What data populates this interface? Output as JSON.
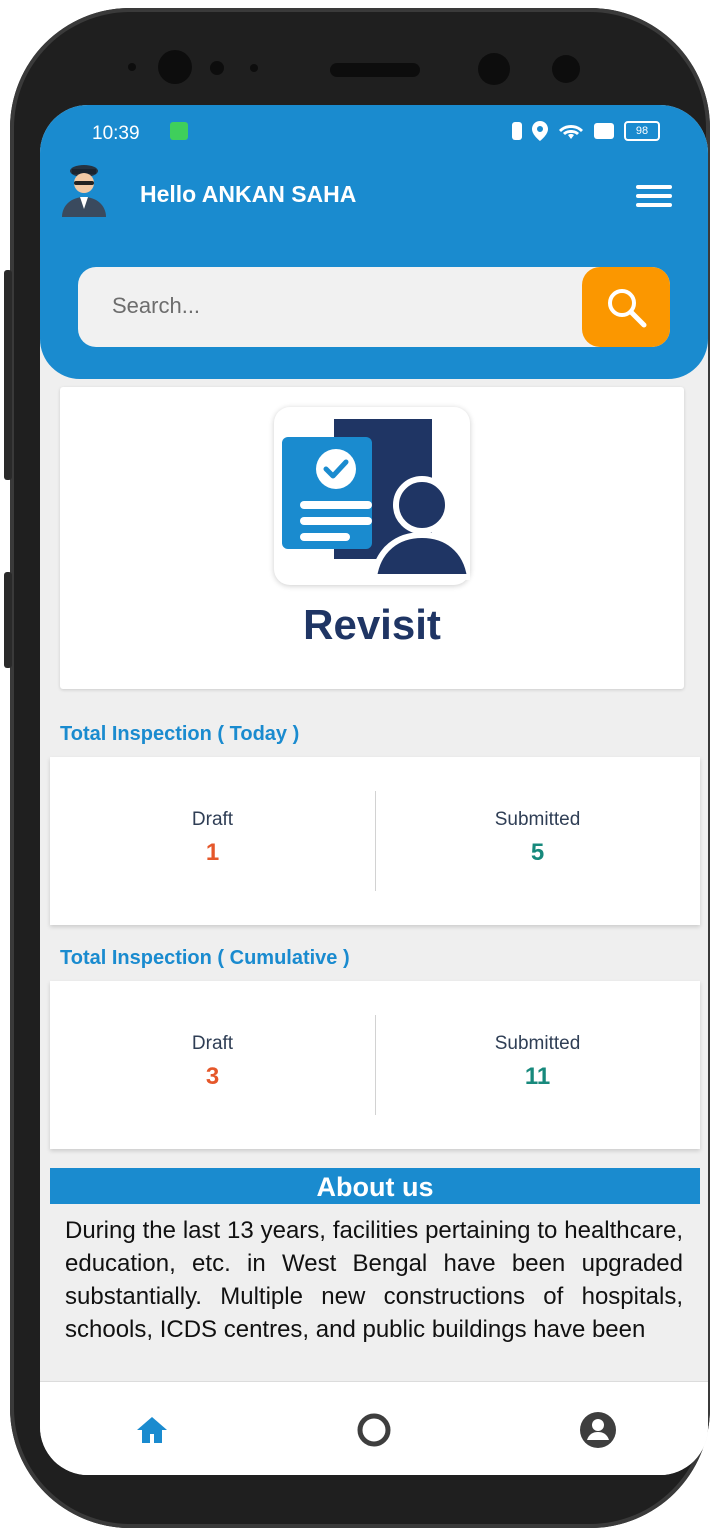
{
  "status_bar": {
    "time": "10:39",
    "battery": "98",
    "icons": [
      "vibrate-icon",
      "location-icon",
      "wifi-icon",
      "message-icon",
      "battery-icon"
    ]
  },
  "header": {
    "greeting": "Hello  ANKAN SAHA",
    "menu_icon": "hamburger-menu-icon",
    "avatar_icon": "officer-avatar-icon",
    "background_color": "#1a8bcf"
  },
  "search": {
    "placeholder": "Search...",
    "button_icon": "search-icon",
    "button_color": "#fb9700"
  },
  "revisit_card": {
    "title": "Revisit",
    "icon": "revisit-document-person-icon"
  },
  "today": {
    "title": "Total Inspection ( Today )",
    "draft_label": "Draft",
    "draft_value": "1",
    "submitted_label": "Submitted",
    "submitted_value": "5"
  },
  "cumulative": {
    "title": "Total Inspection ( Cumulative )",
    "draft_label": "Draft",
    "draft_value": "3",
    "submitted_label": "Submitted",
    "submitted_value": "11"
  },
  "colors": {
    "draft": "#e5572a",
    "submitted": "#17897c",
    "accent": "#1a8bcf"
  },
  "about": {
    "title": "About us",
    "text": "During the last 13 years, facilities pertaining to healthcare, education, etc. in West Bengal have been upgraded substantially. Multiple new constructions of hospitals, schools, ICDS centres, and public buildings have been"
  },
  "bottom_nav": {
    "items": [
      "home-icon",
      "circle-icon",
      "account-icon"
    ]
  }
}
